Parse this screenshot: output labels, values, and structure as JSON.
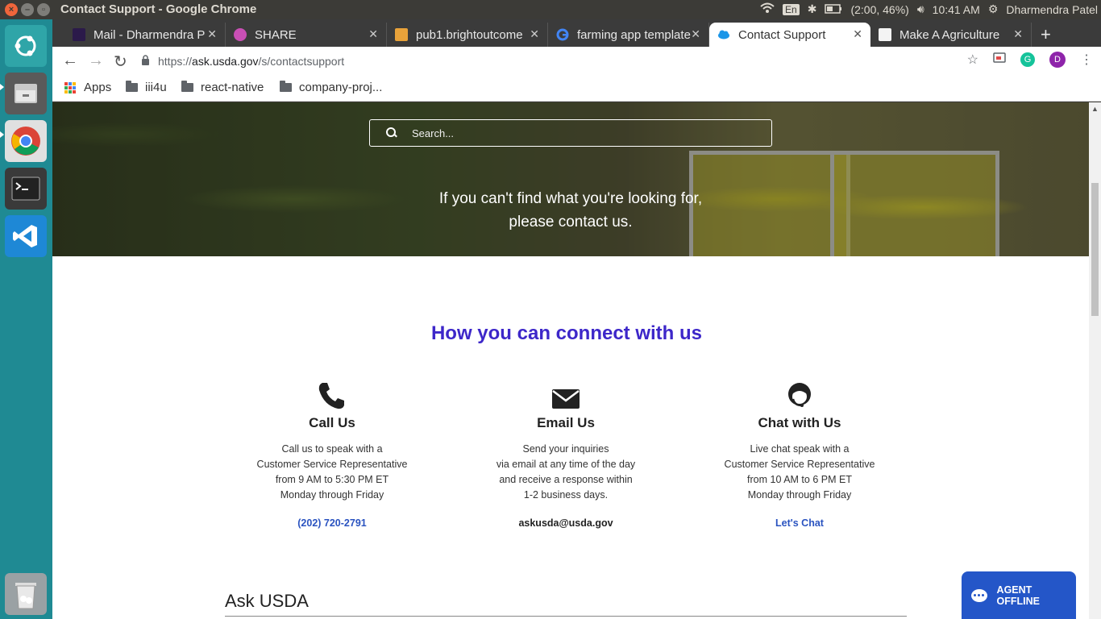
{
  "os": {
    "window_title": "Contact Support - Google Chrome",
    "lang": "En",
    "battery": "(2:00, 46%)",
    "time": "10:41 AM",
    "user": "Dharmendra Patel"
  },
  "tabs": [
    {
      "title": "Mail - Dharmendra P",
      "color": "#2b1a4a"
    },
    {
      "title": "SHARE",
      "color": "#c94fb5"
    },
    {
      "title": "pub1.brightoutcome",
      "color": "#e8a23a"
    },
    {
      "title": "farming app template",
      "color": "#4285f4"
    },
    {
      "title": "Contact Support",
      "color": "#1b96e8"
    },
    {
      "title": "Make A Agriculture",
      "color": "#333333"
    }
  ],
  "omnibox": {
    "scheme": "https://",
    "host": "ask.usda.gov",
    "path": "/s/contactsupport"
  },
  "profile_initial": "D",
  "bookmarks": {
    "apps": "Apps",
    "folders": [
      "iii4u",
      "react-native",
      "company-proj..."
    ]
  },
  "hero": {
    "search_placeholder": "Search...",
    "line1": "If you can't find what you're looking for,",
    "line2": "please contact us."
  },
  "connect": {
    "title": "How you can connect with us",
    "call": {
      "heading": "Call Us",
      "lines": [
        "Call us to speak with a",
        "Customer Service Representative",
        "from 9 AM to 5:30 PM ET",
        "Monday through Friday"
      ],
      "action": "(202) 720-2791"
    },
    "email": {
      "heading": "Email Us",
      "lines": [
        "Send your inquiries",
        "via email at any time of the day",
        "and receive a response within",
        "1-2 business days."
      ],
      "action": "askusda@usda.gov"
    },
    "chat": {
      "heading": "Chat with Us",
      "lines": [
        "Live chat speak with a",
        "Customer Service Representative",
        "from 10 AM to 6 PM ET",
        "Monday through Friday"
      ],
      "action": "Let's Chat"
    }
  },
  "ask_heading": "Ask USDA",
  "agent_status": "AGENT OFFLINE",
  "colors": {
    "accent_title": "#3d27c9",
    "link": "#2a53c0",
    "agent_bg": "#2456c8",
    "launcher": "#1f8a93"
  }
}
